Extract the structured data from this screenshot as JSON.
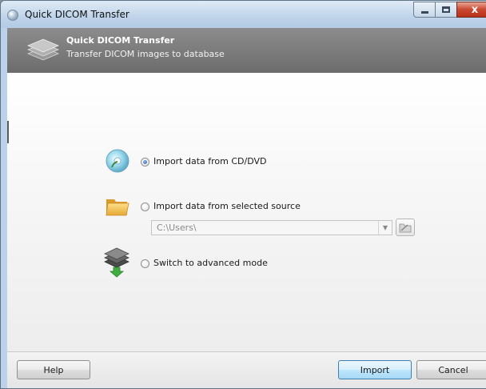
{
  "window": {
    "title": "Quick DICOM Transfer",
    "close_glyph": "x"
  },
  "banner": {
    "title": "Quick DICOM Transfer",
    "subtitle": "Transfer DICOM images to database"
  },
  "options": [
    {
      "label": "Import data from CD/DVD",
      "selected": true,
      "icon": "cd-dvd-icon"
    },
    {
      "label": "Import data from selected source",
      "selected": false,
      "icon": "folder-icon"
    },
    {
      "label": "Switch to advanced mode",
      "selected": false,
      "icon": "advanced-mode-icon"
    }
  ],
  "source_path": {
    "value": "C:\\Users\\"
  },
  "buttons": {
    "help": "Help",
    "import": "Import",
    "cancel": "Cancel"
  },
  "colors": {
    "banner": "#7a7a7a",
    "primary_button": "#bee6fd",
    "close_button": "#c9472f"
  }
}
